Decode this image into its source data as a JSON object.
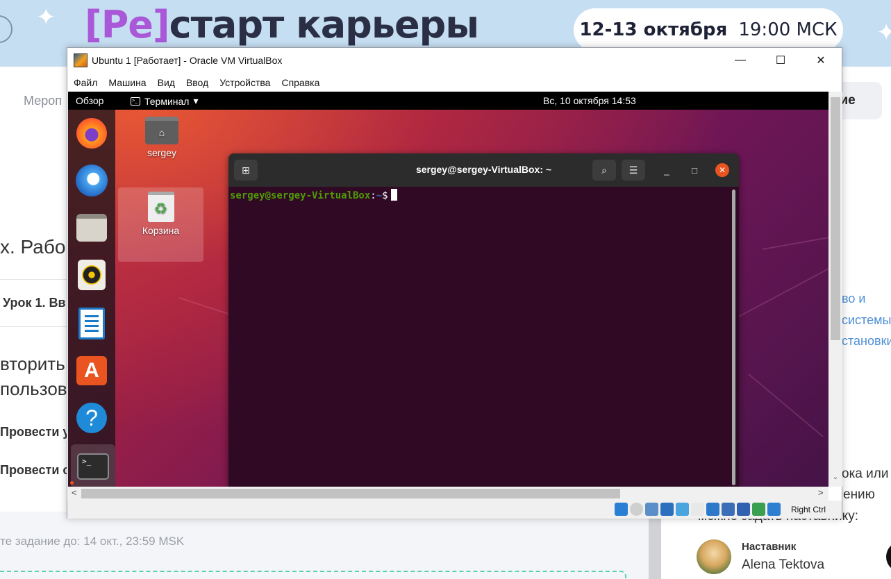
{
  "banner": {
    "logo_bracket_open": "[",
    "logo_re": "Ре",
    "logo_bracket_close": "]",
    "logo_rest": "старт карьеры",
    "event_date": "12-13 октября",
    "event_time": "19:00 МСК"
  },
  "background_page": {
    "nav_text": "Мероп",
    "button_text": "ние",
    "heading": "х. Рабо",
    "lesson": "Урок 1. Вв",
    "task_line1": "вторить",
    "task_line2": "пользов",
    "do_item_1": "Провести у",
    "do_item_2": "Провести с",
    "right_links": [
      "во и",
      "системы",
      "становки"
    ],
    "right_text_1": "ока или",
    "right_text_2": "ению",
    "right_text_3": "можно задать наставнику:",
    "deadline": "те задание до: 14 окт., 23:59 MSK",
    "mentor_label": "Наставник",
    "mentor_name": "Alena Tektova"
  },
  "vbox": {
    "title": "Ubuntu 1 [Работает] - Oracle VM VirtualBox",
    "window_controls": {
      "minimize": "—",
      "maximize": "☐",
      "close": "✕"
    },
    "menu": [
      "Файл",
      "Машина",
      "Вид",
      "Ввод",
      "Устройства",
      "Справка"
    ],
    "host_key": "Right Ctrl",
    "status_icons": [
      "hard-disk",
      "optical-disk",
      "audio",
      "network",
      "usb",
      "shared-folders",
      "display",
      "capture",
      "virtualization",
      "mouse-integration",
      "keyboard-capture"
    ],
    "status_colors": [
      "#2a7fd4",
      "#cfcfcf",
      "#5c8fc8",
      "#2d6fbf",
      "#4aa4e0",
      "#e8e8e8",
      "#2d78c8",
      "#3a6fb8",
      "#3060b0",
      "#3aa050",
      "#2f7fd0"
    ]
  },
  "ubuntu": {
    "top_bar": {
      "overview": "Обзор",
      "app_menu": "Терминал",
      "app_menu_arrow": "▾",
      "clock": "Вс, 10 октября  14:53"
    },
    "dock": [
      "firefox",
      "thunderbird",
      "files",
      "rhythmbox",
      "libreoffice-writer",
      "ubuntu-software",
      "help",
      "terminal"
    ],
    "desktop_icons": [
      {
        "label": "sergey",
        "icon": "home-folder"
      },
      {
        "label": "Корзина",
        "icon": "trash"
      }
    ]
  },
  "terminal": {
    "title": "sergey@sergey-VirtualBox: ~",
    "new_tab_icon": "⊞",
    "search_icon": "⌕",
    "menu_icon": "☰",
    "minimize": "_",
    "maximize": "□",
    "close": "✕",
    "prompt_user": "sergey@sergey-VirtualBox",
    "prompt_sep": ":",
    "prompt_path": "~",
    "prompt_dollar": "$"
  },
  "scroll_arrows": {
    "up": "▲",
    "down": "⌄",
    "left": "<",
    "right": ">"
  }
}
